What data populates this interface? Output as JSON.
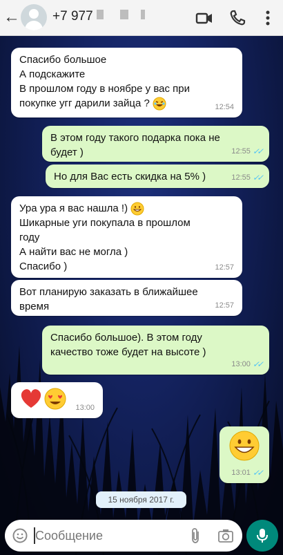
{
  "header": {
    "contact": "+7 977",
    "back_icon": "arrow-left-icon",
    "video_icon": "video-call-icon",
    "call_icon": "phone-icon",
    "menu_icon": "more-vertical-icon"
  },
  "messages": [
    {
      "dir": "in",
      "text": "Спасибо большое\nА подскажите\nВ прошлом году в ноябре у вас при\nпокупке угг  дарили зайца  ?",
      "emoji": "laughing-emoji",
      "time": "12:54"
    },
    {
      "dir": "out",
      "text": "В этом году такого подарка пока не\nбудет )",
      "time": "12:55"
    },
    {
      "dir": "out",
      "text": "Но для Вас есть скидка на 5% )",
      "time": "12:55"
    },
    {
      "dir": "in",
      "text": "Ура ура я вас нашла !)",
      "text2": "Шикарные уги покупала в прошлом\nгоду\nА найти вас не могла )\nСпасибо )",
      "emoji": "grinning-emoji",
      "time": "12:57"
    },
    {
      "dir": "in",
      "text": "Вот планирую заказать в ближайшее\nвремя",
      "time": "12:57"
    },
    {
      "dir": "out",
      "text": "Спасибо большое). В этом году\nкачество тоже будет на высоте )",
      "time": "13:00"
    },
    {
      "dir": "in",
      "emoji": "heart-and-heart-eyes-emoji",
      "time": "13:00"
    },
    {
      "dir": "out",
      "emoji": "big-grin-emoji",
      "time": "13:01"
    }
  ],
  "date_divider": "15 ноября 2017 г.",
  "composer": {
    "placeholder": "Сообщение",
    "emoji_icon": "emoji-icon",
    "attach_icon": "paperclip-icon",
    "camera_icon": "camera-icon",
    "mic_icon": "microphone-icon"
  },
  "colors": {
    "incoming": "#ffffff",
    "outgoing": "#dcf8c6",
    "read_ticks": "#4fc3f7",
    "mic_button": "#00897b"
  }
}
